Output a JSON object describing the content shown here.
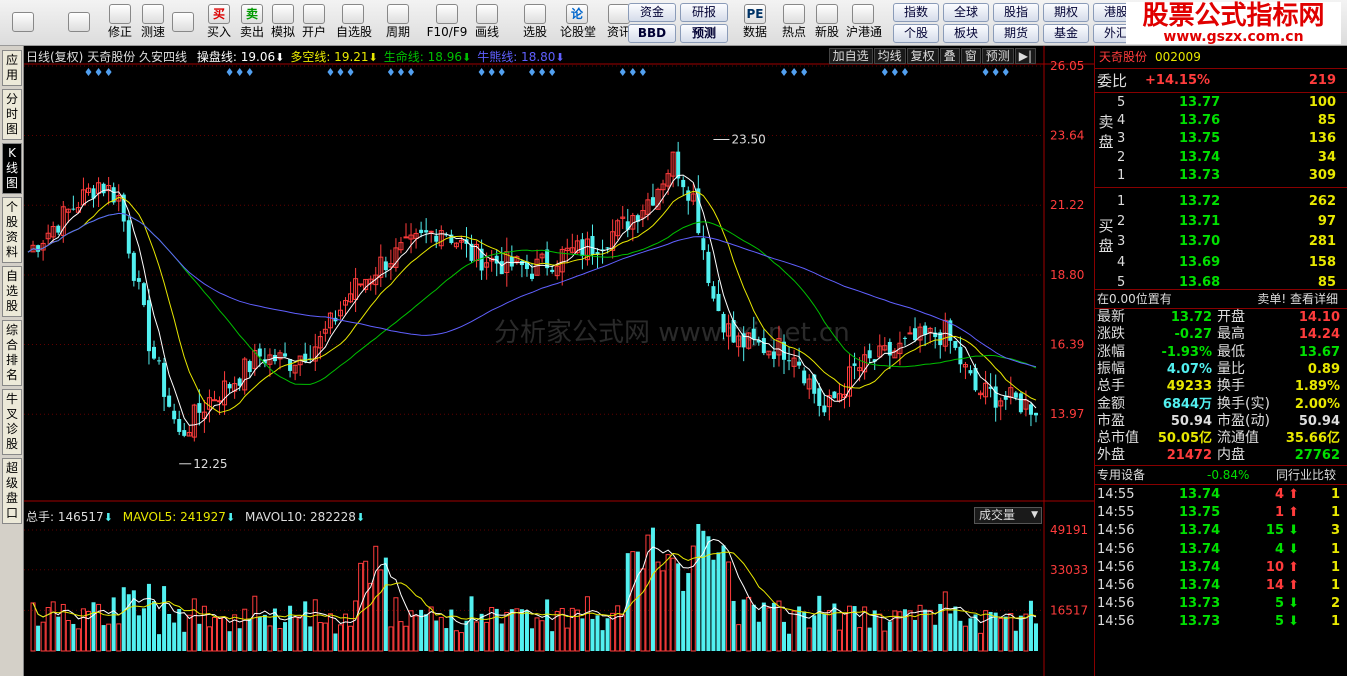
{
  "toolbar": {
    "buttons": [
      {
        "label": "",
        "icon": "windows-grid-icon"
      },
      {
        "label": "",
        "icon": "back-arrow-icon"
      },
      {
        "label": "修正",
        "icon": "up-down-arrow-icon"
      },
      {
        "label": "测速",
        "icon": "speedometer-icon"
      },
      {
        "label": "",
        "icon": "clock-icon"
      },
      {
        "label": "买入",
        "icon": "buy-icon",
        "glyph": "买"
      },
      {
        "label": "卖出",
        "icon": "sell-icon",
        "glyph": "卖"
      },
      {
        "label": "模拟",
        "icon": "hammer-icon"
      },
      {
        "label": "开户",
        "icon": "lock-icon"
      },
      {
        "label": "自选股",
        "icon": "star-icon"
      },
      {
        "label": "周期",
        "icon": "clock-cycle-icon"
      },
      {
        "label": "F10/F9",
        "icon": "f10-icon"
      },
      {
        "label": "画线",
        "icon": "pen-icon"
      },
      {
        "label": "选股",
        "icon": "monitor-icon"
      },
      {
        "label": "论股堂",
        "icon": "forum-icon",
        "glyph": "论"
      },
      {
        "label": "资讯",
        "icon": "news-icon"
      },
      {
        "label": "数据",
        "icon": "pe-icon",
        "glyph": "PE"
      },
      {
        "label": "热点",
        "icon": "flame-icon"
      },
      {
        "label": "新股",
        "icon": "ipo-icon"
      },
      {
        "label": "沪港通",
        "icon": "sse-hkex-icon"
      }
    ],
    "pills_a": [
      {
        "top": "资金",
        "bottom": "BBD"
      },
      {
        "top": "研报",
        "bottom": "预测"
      }
    ],
    "pills_b": [
      {
        "top": "指数",
        "bottom": "个股"
      },
      {
        "top": "全球",
        "bottom": "板块"
      },
      {
        "top": "股指",
        "bottom": "期货"
      },
      {
        "top": "期权",
        "bottom": "基金"
      },
      {
        "top": "港股",
        "bottom": "外汇"
      }
    ],
    "logo": {
      "title": "股票公式指标网",
      "url": "www.gszx.com.cn"
    }
  },
  "left_tabs": [
    "应用",
    "分时图",
    "K线图",
    "个股资料",
    "自选股",
    "综合排名",
    "牛叉诊股",
    "超级盘口"
  ],
  "chart": {
    "header": {
      "period": "日线(复权)",
      "stock": "天奇股份",
      "indicator": "久安四线",
      "lines": [
        {
          "label": "操盘线: 19.06",
          "color": "#ffffff"
        },
        {
          "label": "多空线: 19.21",
          "color": "#e8e800"
        },
        {
          "label": "生命线: 18.96",
          "color": "#00c000"
        },
        {
          "label": "牛熊线: 18.80",
          "color": "#6060ff"
        }
      ]
    },
    "tools": [
      "加自选",
      "均线",
      "复权",
      "叠",
      "窗",
      "预测"
    ],
    "price_ticks": [
      "26.05",
      "23.64",
      "21.22",
      "18.80",
      "16.39",
      "13.97"
    ],
    "high_label": "23.50",
    "low_label": "12.25",
    "volume_header": {
      "total": "总手: 146517",
      "mavol5": "MAVOL5: 241927",
      "mavol10": "MAVOL10: 282228",
      "selector": "成交量"
    },
    "volume_ticks": [
      "49191",
      "33033",
      "16517"
    ],
    "watermark": "分析家公式网 www.fxj.net.cn"
  },
  "panel": {
    "header": {
      "name": "天奇股份",
      "code": "002009"
    },
    "weibi": {
      "label": "委比",
      "pct": "+14.15%",
      "diff": "219"
    },
    "sell_label": "卖盘",
    "buy_label": "买盘",
    "asks": [
      {
        "level": "5",
        "price": "13.77",
        "vol": "100"
      },
      {
        "level": "4",
        "price": "13.76",
        "vol": "85"
      },
      {
        "level": "3",
        "price": "13.75",
        "vol": "136"
      },
      {
        "level": "2",
        "price": "13.74",
        "vol": "34"
      },
      {
        "level": "1",
        "price": "13.73",
        "vol": "309"
      }
    ],
    "bids": [
      {
        "level": "1",
        "price": "13.72",
        "vol": "262"
      },
      {
        "level": "2",
        "price": "13.71",
        "vol": "97"
      },
      {
        "level": "3",
        "price": "13.70",
        "vol": "281"
      },
      {
        "level": "4",
        "price": "13.69",
        "vol": "158"
      },
      {
        "level": "5",
        "price": "13.68",
        "vol": "85"
      }
    ],
    "position_text": "在0.00位置有",
    "sell_detail": "卖单! 查看详细",
    "stats": [
      {
        "l1": "最新",
        "v1": "13.72",
        "c1": "green",
        "l2": "开盘",
        "v2": "14.10",
        "c2": "red"
      },
      {
        "l1": "涨跌",
        "v1": "-0.27",
        "c1": "green",
        "l2": "最高",
        "v2": "14.24",
        "c2": "red"
      },
      {
        "l1": "涨幅",
        "v1": "-1.93%",
        "c1": "green",
        "l2": "最低",
        "v2": "13.67",
        "c2": "green"
      },
      {
        "l1": "振幅",
        "v1": "4.07%",
        "c1": "cyan",
        "l2": "量比",
        "v2": "0.89",
        "c2": "yellow"
      },
      {
        "l1": "总手",
        "v1": "49233",
        "c1": "yellow",
        "l2": "换手",
        "v2": "1.89%",
        "c2": "yellow"
      },
      {
        "l1": "金额",
        "v1": "6844万",
        "c1": "cyan",
        "l2": "换手(实)",
        "v2": "2.00%",
        "c2": "yellow"
      },
      {
        "l1": "市盈",
        "v1": "50.94",
        "c1": "white",
        "l2": "市盈(动)",
        "v2": "50.94",
        "c2": "white"
      },
      {
        "l1": "总市值",
        "v1": "50.05亿",
        "c1": "yellow",
        "l2": "流通值",
        "v2": "35.66亿",
        "c2": "yellow"
      },
      {
        "l1": "外盘",
        "v1": "21472",
        "c1": "red",
        "l2": "内盘",
        "v2": "27762",
        "c2": "green"
      }
    ],
    "sector": {
      "name": "专用设备",
      "pct": "-0.84%",
      "compare": "同行业比较"
    },
    "ticks": [
      {
        "time": "14:55",
        "price": "13.74",
        "vol": "4",
        "dir": "up",
        "n": "1"
      },
      {
        "time": "14:55",
        "price": "13.75",
        "vol": "1",
        "dir": "up",
        "n": "1"
      },
      {
        "time": "14:56",
        "price": "13.74",
        "vol": "15",
        "dir": "down",
        "n": "3"
      },
      {
        "time": "14:56",
        "price": "13.74",
        "vol": "4",
        "dir": "down",
        "n": "1"
      },
      {
        "time": "14:56",
        "price": "13.74",
        "vol": "10",
        "dir": "up",
        "n": "1"
      },
      {
        "time": "14:56",
        "price": "13.74",
        "vol": "14",
        "dir": "up",
        "n": "1"
      },
      {
        "time": "14:56",
        "price": "13.73",
        "vol": "5",
        "dir": "down",
        "n": "2"
      },
      {
        "time": "14:56",
        "price": "13.73",
        "vol": "5",
        "dir": "down",
        "n": "1"
      }
    ]
  },
  "colors": {
    "up": "#ff3c3c",
    "down": "#52f0f0",
    "grid": "#800000"
  }
}
